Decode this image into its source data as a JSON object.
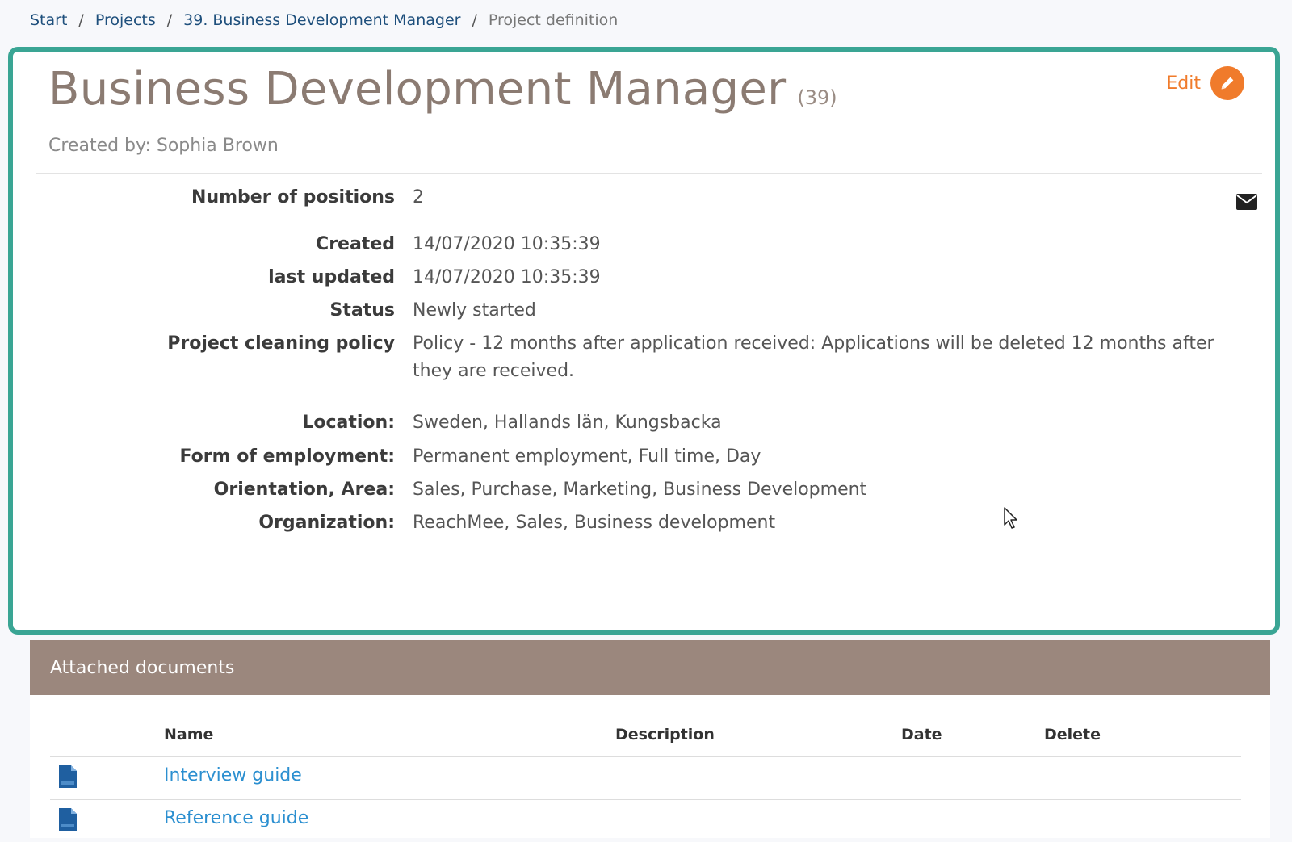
{
  "breadcrumb": {
    "items": [
      "Start",
      "Projects",
      "39. Business Development Manager"
    ],
    "current": "Project definition",
    "separator": "/"
  },
  "project": {
    "title": "Business Development Manager",
    "count": "(39)",
    "created_by": "Created by: Sophia Brown",
    "edit_label": "Edit"
  },
  "fields": {
    "positions": {
      "label": "Number of positions",
      "value": "2"
    },
    "created": {
      "label": "Created",
      "value": "14/07/2020 10:35:39"
    },
    "last_updated": {
      "label": "last updated",
      "value": "14/07/2020 10:35:39"
    },
    "status": {
      "label": "Status",
      "value": "Newly started"
    },
    "cleaning_policy": {
      "label": "Project cleaning policy",
      "value": "Policy - 12 months after application received: Applications will be deleted 12 months after they are received."
    },
    "location": {
      "label": "Location:",
      "value": "Sweden, Hallands län, Kungsbacka"
    },
    "employment": {
      "label": "Form of employment:",
      "value": "Permanent employment, Full time, Day"
    },
    "orientation": {
      "label": "Orientation, Area:",
      "value": "Sales, Purchase, Marketing, Business Development"
    },
    "organization": {
      "label": "Organization:",
      "value": "ReachMee, Sales, Business development"
    }
  },
  "documents": {
    "header": "Attached documents",
    "columns": {
      "name": "Name",
      "description": "Description",
      "date": "Date",
      "delete": "Delete"
    },
    "rows": [
      {
        "name": "Interview guide"
      },
      {
        "name": "Reference guide"
      }
    ]
  },
  "colors": {
    "accent_border": "#3aa594",
    "edit_orange": "#f07b2b",
    "docs_header_bg": "#9b877d",
    "link_blue": "#2b8fd0",
    "breadcrumb_blue": "#1e4f7c"
  },
  "icons": [
    "pencil-icon",
    "envelope-icon",
    "document-icon",
    "mouse-cursor-icon"
  ]
}
